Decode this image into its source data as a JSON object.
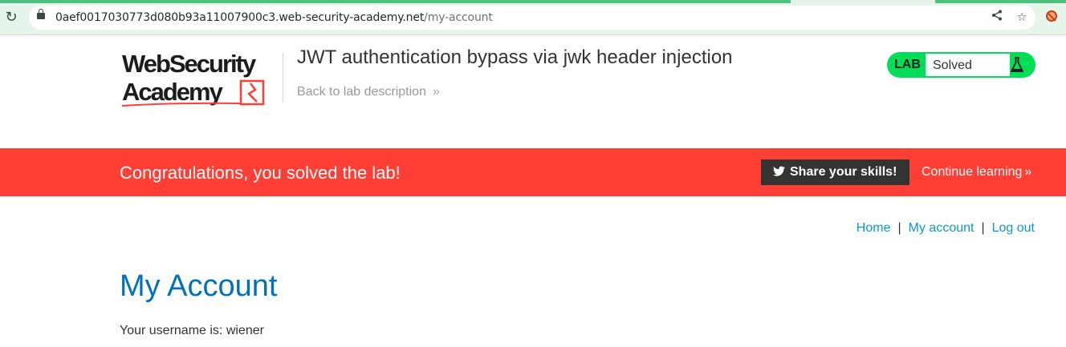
{
  "browser": {
    "url_host": "0aef0017030773d080b93a11007900c3.web-security-academy.net",
    "url_path": "/my-account",
    "icons": [
      "reload-icon",
      "lock-icon",
      "share-icon",
      "star-icon",
      "extension-icon"
    ]
  },
  "header": {
    "logo_line1": "WebSecurity",
    "logo_line2": "Academy",
    "lab_title": "JWT authentication bypass via jwk header injection",
    "back_link": "Back to lab description",
    "back_chevron": "»",
    "badge_label": "LAB",
    "badge_status": "Solved"
  },
  "banner": {
    "message": "Congratulations, you solved the lab!",
    "share_button": "Share your skills!",
    "continue_link": "Continue learning",
    "continue_chevron": "»"
  },
  "nav": {
    "home": "Home",
    "my_account": "My account",
    "logout": "Log out",
    "separator": "|"
  },
  "main": {
    "title": "My Account",
    "username_text": "Your username is: wiener"
  },
  "colors": {
    "banner": "#ff3e36",
    "badge": "#00de57",
    "link": "#0c99c6",
    "title": "#0071bc"
  }
}
